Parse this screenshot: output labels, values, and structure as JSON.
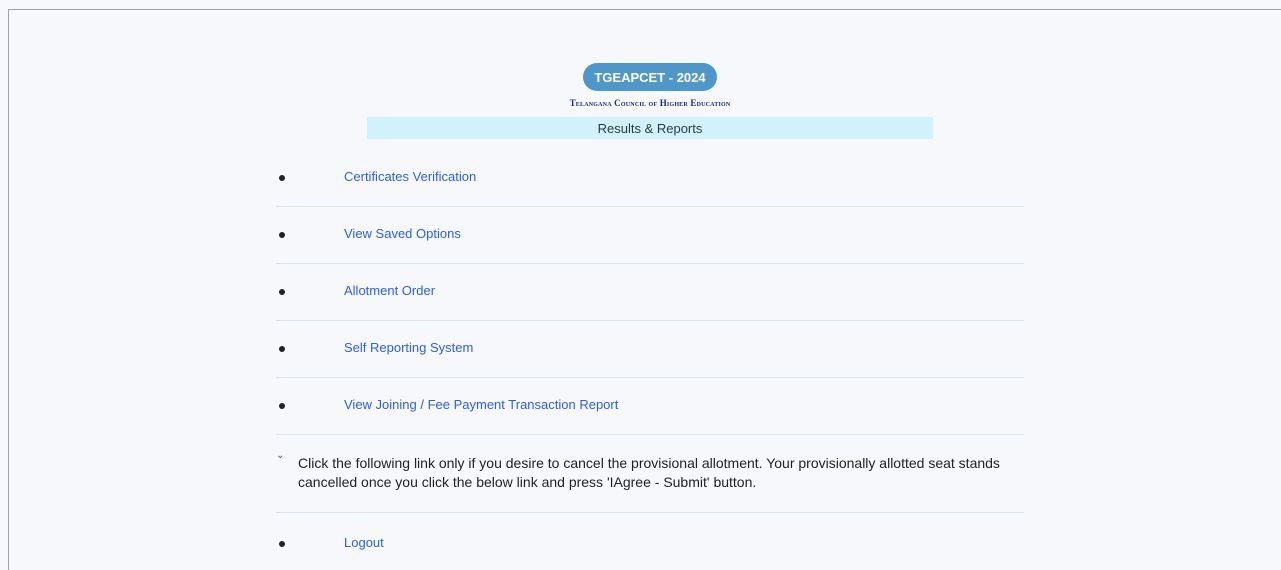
{
  "header": {
    "badge": "TGEAPCET - 2024",
    "council": "Telangana Council of Higher Education",
    "section_title": "Results & Reports"
  },
  "menu": {
    "items": [
      {
        "label": "Certificates Verification"
      },
      {
        "label": "View Saved Options"
      },
      {
        "label": "Allotment Order"
      },
      {
        "label": "Self Reporting System"
      },
      {
        "label": "View Joining / Fee Payment Transaction Report"
      }
    ],
    "notice": "Click the following link only if you desire to cancel the provisional allotment. Your provisionally allotted seat stands cancelled once you click the below link and press 'IAgree - Submit' button.",
    "logout": "Logout"
  },
  "colors": {
    "badge_bg": "#4f97c8",
    "council_text": "#1b2b7a",
    "results_bar_bg": "#d1f2fb",
    "link": "#2d5ee8"
  },
  "icons": {
    "bullet": "bullet-icon",
    "chevron": "chevron-down-icon"
  }
}
